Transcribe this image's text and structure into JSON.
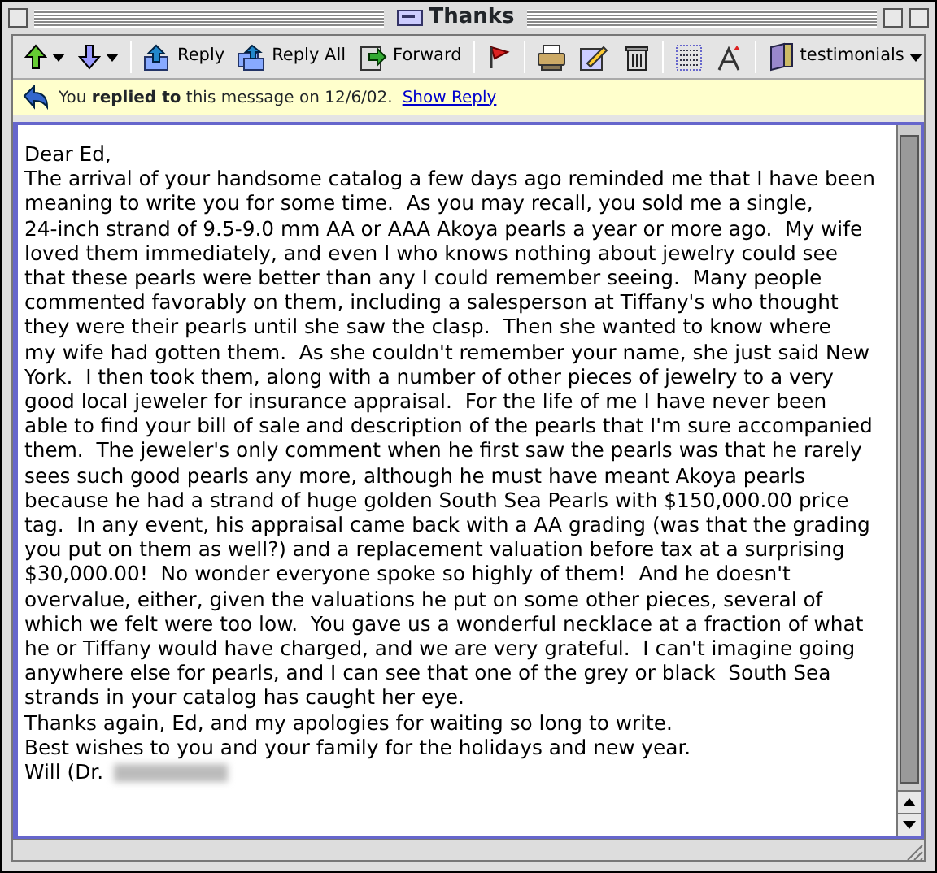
{
  "window": {
    "title": "Thanks"
  },
  "toolbar": {
    "buttons": [
      "Reply",
      "Reply All",
      "Forward"
    ],
    "folder": "testimonials"
  },
  "info_bar": {
    "message": "You **replied to** this message on 12/6/02.",
    "link": "Show Reply"
  },
  "body": {
    "lines": [
      "Dear Ed,",
      "The arrival of your handsome catalog a few days ago reminded me that I have been",
      "meaning to write you for some time.  As you may recall, you sold me a single,",
      "24-inch strand of 9.5-9.0 mm AA or AAA Akoya pearls a year or more ago.  My wife",
      "loved them immediately, and even I who knows nothing about jewelry could see",
      "that these pearls were better than any I could remember seeing.  Many people",
      "commented favorably on them, including a salesperson at Tiffany's who thought",
      "they were their pearls until she saw the clasp.  Then she wanted to know where",
      "my wife had gotten them.  As she couldn't remember your name, she just said New",
      "York.  I then took them, along with a number of other pieces of jewelry to a very",
      "good local jeweler for insurance appraisal.  For the life of me I have never been",
      "able to find your bill of sale and description of the pearls that I'm sure accompanied",
      "them.  The jeweler's only comment when he first saw the pearls was that he rarely",
      "sees such good pearls any more, although he must have meant Akoya pearls",
      "because he had a strand of huge golden South Sea Pearls with $150,000.00 price",
      "tag.  In any event, his appraisal came back with a AA grading (was that the grading",
      "you put on them as well?) and a replacement valuation before tax at a surprising",
      "$30,000.00!  No wonder everyone spoke so highly of them!  And he doesn't",
      "overvalue, either, given the valuations he put on some other pieces, several of",
      "which we felt were too low.  You gave us a wonderful necklace at a fraction of what",
      "he or Tiffany would have charged, and we are very grateful.  I can't imagine going",
      "anywhere else for pearls, and I can see that one of the grey or black  South Sea",
      "strands in your catalog has caught her eye.",
      "Thanks again, Ed, and my apologies for waiting so long to write.",
      "Best wishes to you and your family for the holidays and new year."
    ],
    "signature": "Will (Dr."
  }
}
